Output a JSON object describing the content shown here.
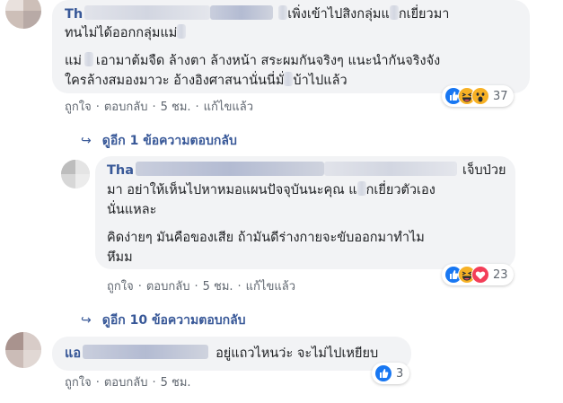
{
  "comments": [
    {
      "name_visible": "Th",
      "lines": [
        "เพิ่งเข้าไปสิงกลุ่มแ",
        "กเยี่ยวมา",
        "ทนไม่ได้ออกกลุ่มแม่",
        "แม่",
        "เอามาต้มจืด ล้างตา ล้างหน้า สระผมกันจริงๆ แนะนำกันจริงจัง",
        "ใครล้างสมองมาวะ อ้างอิงศาสนานั่นนี่มั่",
        "บ้าไปแล้ว"
      ],
      "actions": {
        "like": "ถูกใจ",
        "reply": "ตอบกลับ",
        "time": "5 ชม.",
        "edited": "แก้ไขแล้ว"
      },
      "reaction_count": "37"
    },
    {
      "name_visible": "Tha",
      "lines": [
        "เจ็บป่วย",
        "มา อย่าให้เห็นไปหาหมอแผนปัจจุบันนะคุณ แ",
        "กเยี่ยวตัวเอง",
        "นั่นแหละ",
        "คิดง่ายๆ มันคือของเสีย ถ้ามันดีร่างกายจะขับออกมาทำไม",
        "หึมม"
      ],
      "actions": {
        "like": "ถูกใจ",
        "reply": "ตอบกลับ",
        "time": "5 ชม.",
        "edited": "แก้ไขแล้ว"
      },
      "reaction_count": "23"
    },
    {
      "name_visible": "แอ",
      "lines": [
        "อยู่แถวไหนว่ะ จะไม่ไปเหยียบ"
      ],
      "actions": {
        "like": "ถูกใจ",
        "reply": "ตอบกลับ",
        "time": "5 ชม."
      },
      "reaction_count": "3"
    }
  ],
  "view_more_replies_1": "ดูอีก 1 ข้อความตอบกลับ",
  "view_more_replies_2": "ดูอีก 10 ข้อความตอบกลับ",
  "separator": "·",
  "colors": {
    "link": "#385898",
    "bubble": "#f2f3f5",
    "meta": "#606770",
    "like_blue": "#1877f2",
    "haha_yellow": "#f7b125",
    "heart_red": "#f33e58"
  },
  "icons": [
    "like-reaction-icon",
    "haha-reaction-icon",
    "wow-reaction-icon",
    "love-reaction-icon",
    "reply-arrow-icon"
  ]
}
